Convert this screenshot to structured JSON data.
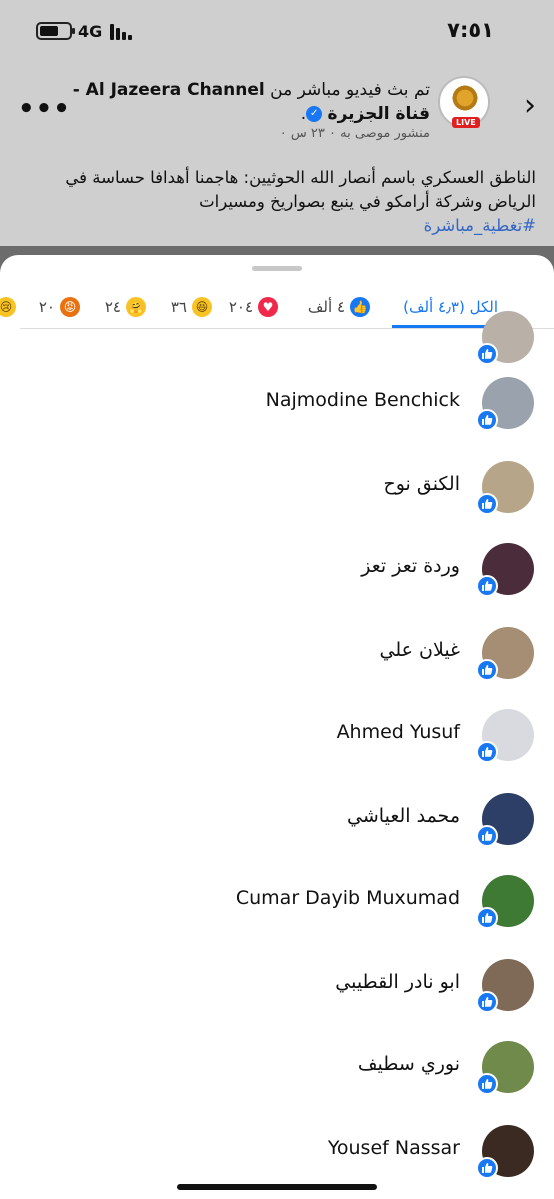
{
  "status_bar": {
    "time": "٧:٥١",
    "network": "4G"
  },
  "post": {
    "title": "تم بث فيديو مباشر من Al Jazeera Channel - قناة الجزيرة",
    "title_prefix": "تم بث فيديو مباشر من",
    "page_name": "Al Jazeera Channel - قناة الجزيرة",
    "meta": "منشور موصى به ٠ ٢٣ س ٠",
    "live_badge": "LIVE",
    "text": "الناطق العسكري باسم أنصار الله الحوثيين: هاجمنا أهدافا حساسة في الرياض وشركة أرامكو في ينبع بصواريخ ومسيرات",
    "hashtag": "#تغطية_مباشرة"
  },
  "tabs": [
    {
      "label": "الكل (٤٫٣ ألف)",
      "type": "all",
      "active": true
    },
    {
      "label": "٤ ألف",
      "type": "like"
    },
    {
      "label": "٢٠٤",
      "type": "love"
    },
    {
      "label": "٣٦",
      "type": "haha"
    },
    {
      "label": "٢٤",
      "type": "care"
    },
    {
      "label": "٢٠",
      "type": "angry"
    },
    {
      "label": "",
      "type": "sad"
    }
  ],
  "reactors": [
    {
      "name": "Najmodine Benchick",
      "avatar_color": "#9aa3ad"
    },
    {
      "name": "الكنق نوح",
      "avatar_color": "#b7a58a"
    },
    {
      "name": "وردة تعز تعز",
      "avatar_color": "#4a2c3a"
    },
    {
      "name": "غيلان علي",
      "avatar_color": "#a58e74"
    },
    {
      "name": "Ahmed Yusuf",
      "avatar_color": "#d8dadf"
    },
    {
      "name": "محمد العياشي",
      "avatar_color": "#2d3f66"
    },
    {
      "name": "Cumar Dayib Muxumad",
      "avatar_color": "#3f7a35"
    },
    {
      "name": "ابو نادر القطيبي",
      "avatar_color": "#7f6a58"
    },
    {
      "name": "نوري سطيف",
      "avatar_color": "#6f8a4a"
    },
    {
      "name": "Yousef Nassar",
      "avatar_color": "#3a2a22"
    }
  ],
  "icons": {
    "like": "thumbs-up-icon",
    "back": "chevron-right-icon",
    "more": "more-icon"
  },
  "colors": {
    "accent": "#1877f2",
    "love": "#f0284a",
    "angry": "#e9710f"
  }
}
